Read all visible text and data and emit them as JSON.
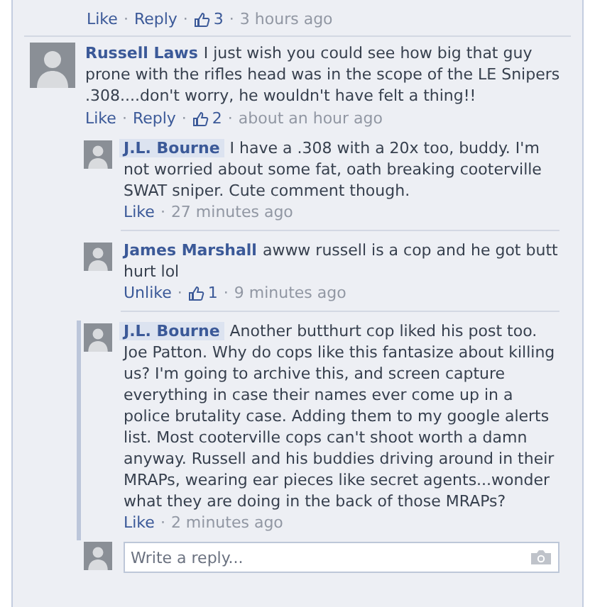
{
  "separator": "·",
  "top_meta": {
    "actions": [
      "Like",
      "Reply"
    ],
    "likes": "3",
    "time": "3 hours ago"
  },
  "comment": {
    "author": "Russell Laws",
    "name_highlighted": false,
    "text": "I just wish you could see how big that guy prone with the rifles head was in the scope of the LE Snipers .308....don't worry, he wouldn't have felt a thing!!",
    "actions": [
      "Like",
      "Reply"
    ],
    "likes": "2",
    "time": "about an hour ago",
    "replies": [
      {
        "author": "J.L. Bourne",
        "name_highlighted": true,
        "marked": false,
        "text": "I have a .308 with a 20x too, buddy. I'm not worried about some fat, oath breaking cooterville SWAT sniper. Cute comment though.",
        "actions": [
          "Like"
        ],
        "time": "27 minutes ago"
      },
      {
        "author": "James Marshall",
        "name_highlighted": false,
        "marked": false,
        "text": "awww russell is a cop and he got butt hurt lol",
        "actions": [
          "Unlike"
        ],
        "likes": "1",
        "time": "9 minutes ago"
      },
      {
        "author": "J.L. Bourne",
        "name_highlighted": true,
        "marked": true,
        "text": "Another butthurt cop liked his post too. Joe Patton. Why do cops like this fantasize about killing us? I'm going to archive this, and screen capture everything in case their names ever come up in a police brutality case. Adding them to my google alerts list. Most cooterville cops can't shoot worth a damn anyway. Russell and his buddies driving around in their MRAPs, wearing ear pieces like secret agents...wonder what they are doing in the back of those MRAPs?",
        "actions": [
          "Like"
        ],
        "time": "2 minutes ago"
      }
    ]
  },
  "reply_box": {
    "placeholder": "Write a reply..."
  }
}
